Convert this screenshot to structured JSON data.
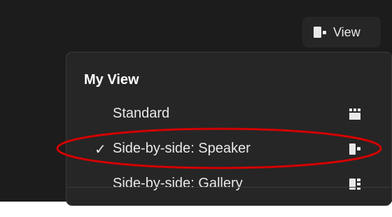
{
  "view_button": {
    "label": "View",
    "icon": "speaker-view-icon"
  },
  "view_menu": {
    "heading": "My View",
    "items": [
      {
        "label": "Standard",
        "checked": false,
        "icon": "standard-grid-icon"
      },
      {
        "label": "Side-by-side: Speaker",
        "checked": true,
        "check_glyph": "✓",
        "icon": "side-by-side-speaker-icon"
      },
      {
        "label": "Side-by-side: Gallery",
        "checked": false,
        "icon": "side-by-side-gallery-icon"
      }
    ]
  },
  "annotation": {
    "highlight_color": "#d40000",
    "highlighted_item": "Side-by-side: Speaker"
  },
  "colors": {
    "background": "#1c1c1c",
    "menu_background": "#262626",
    "text": "#e9e9e9",
    "heading": "#ffffff"
  }
}
